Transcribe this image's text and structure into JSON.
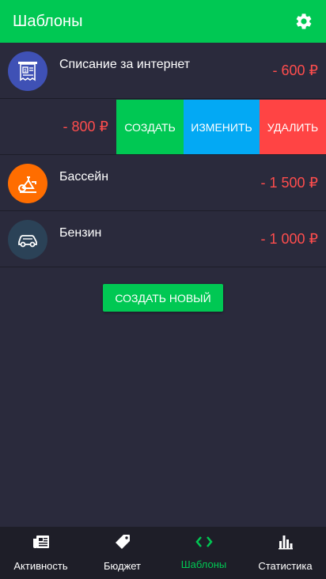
{
  "header": {
    "title": "Шаблоны"
  },
  "templates": [
    {
      "name": "Списание за интернет",
      "amount": "- 600 ₽",
      "icon": "receipt-icon",
      "icon_color": "#3f51b5"
    },
    {
      "name": "Бассейн",
      "amount": "- 1 500 ₽",
      "icon": "exercise-bike-icon",
      "icon_color": "#ff6d00"
    },
    {
      "name": "Бензин",
      "amount": "- 1 000 ₽",
      "icon": "car-icon",
      "icon_color": "#2b4257"
    }
  ],
  "swiped_row": {
    "amount": "- 800 ₽",
    "actions": {
      "create": "СОЗДАТЬ",
      "edit": "ИЗМЕНИТЬ",
      "delete": "УДАЛИТЬ"
    },
    "colors": {
      "create": "#00c853",
      "edit": "#03a9f4",
      "delete": "#ff4444"
    }
  },
  "create_new_label": "СОЗДАТЬ НОВЫЙ",
  "nav": [
    {
      "label": "Активность",
      "icon": "newspaper-icon"
    },
    {
      "label": "Бюджет",
      "icon": "tag-icon"
    },
    {
      "label": "Шаблоны",
      "icon": "code-icon",
      "active": true
    },
    {
      "label": "Статистика",
      "icon": "bar-chart-icon"
    }
  ],
  "colors": {
    "accent": "#00c853",
    "negative": "#ff4d4d",
    "background": "#2a2a3c"
  }
}
